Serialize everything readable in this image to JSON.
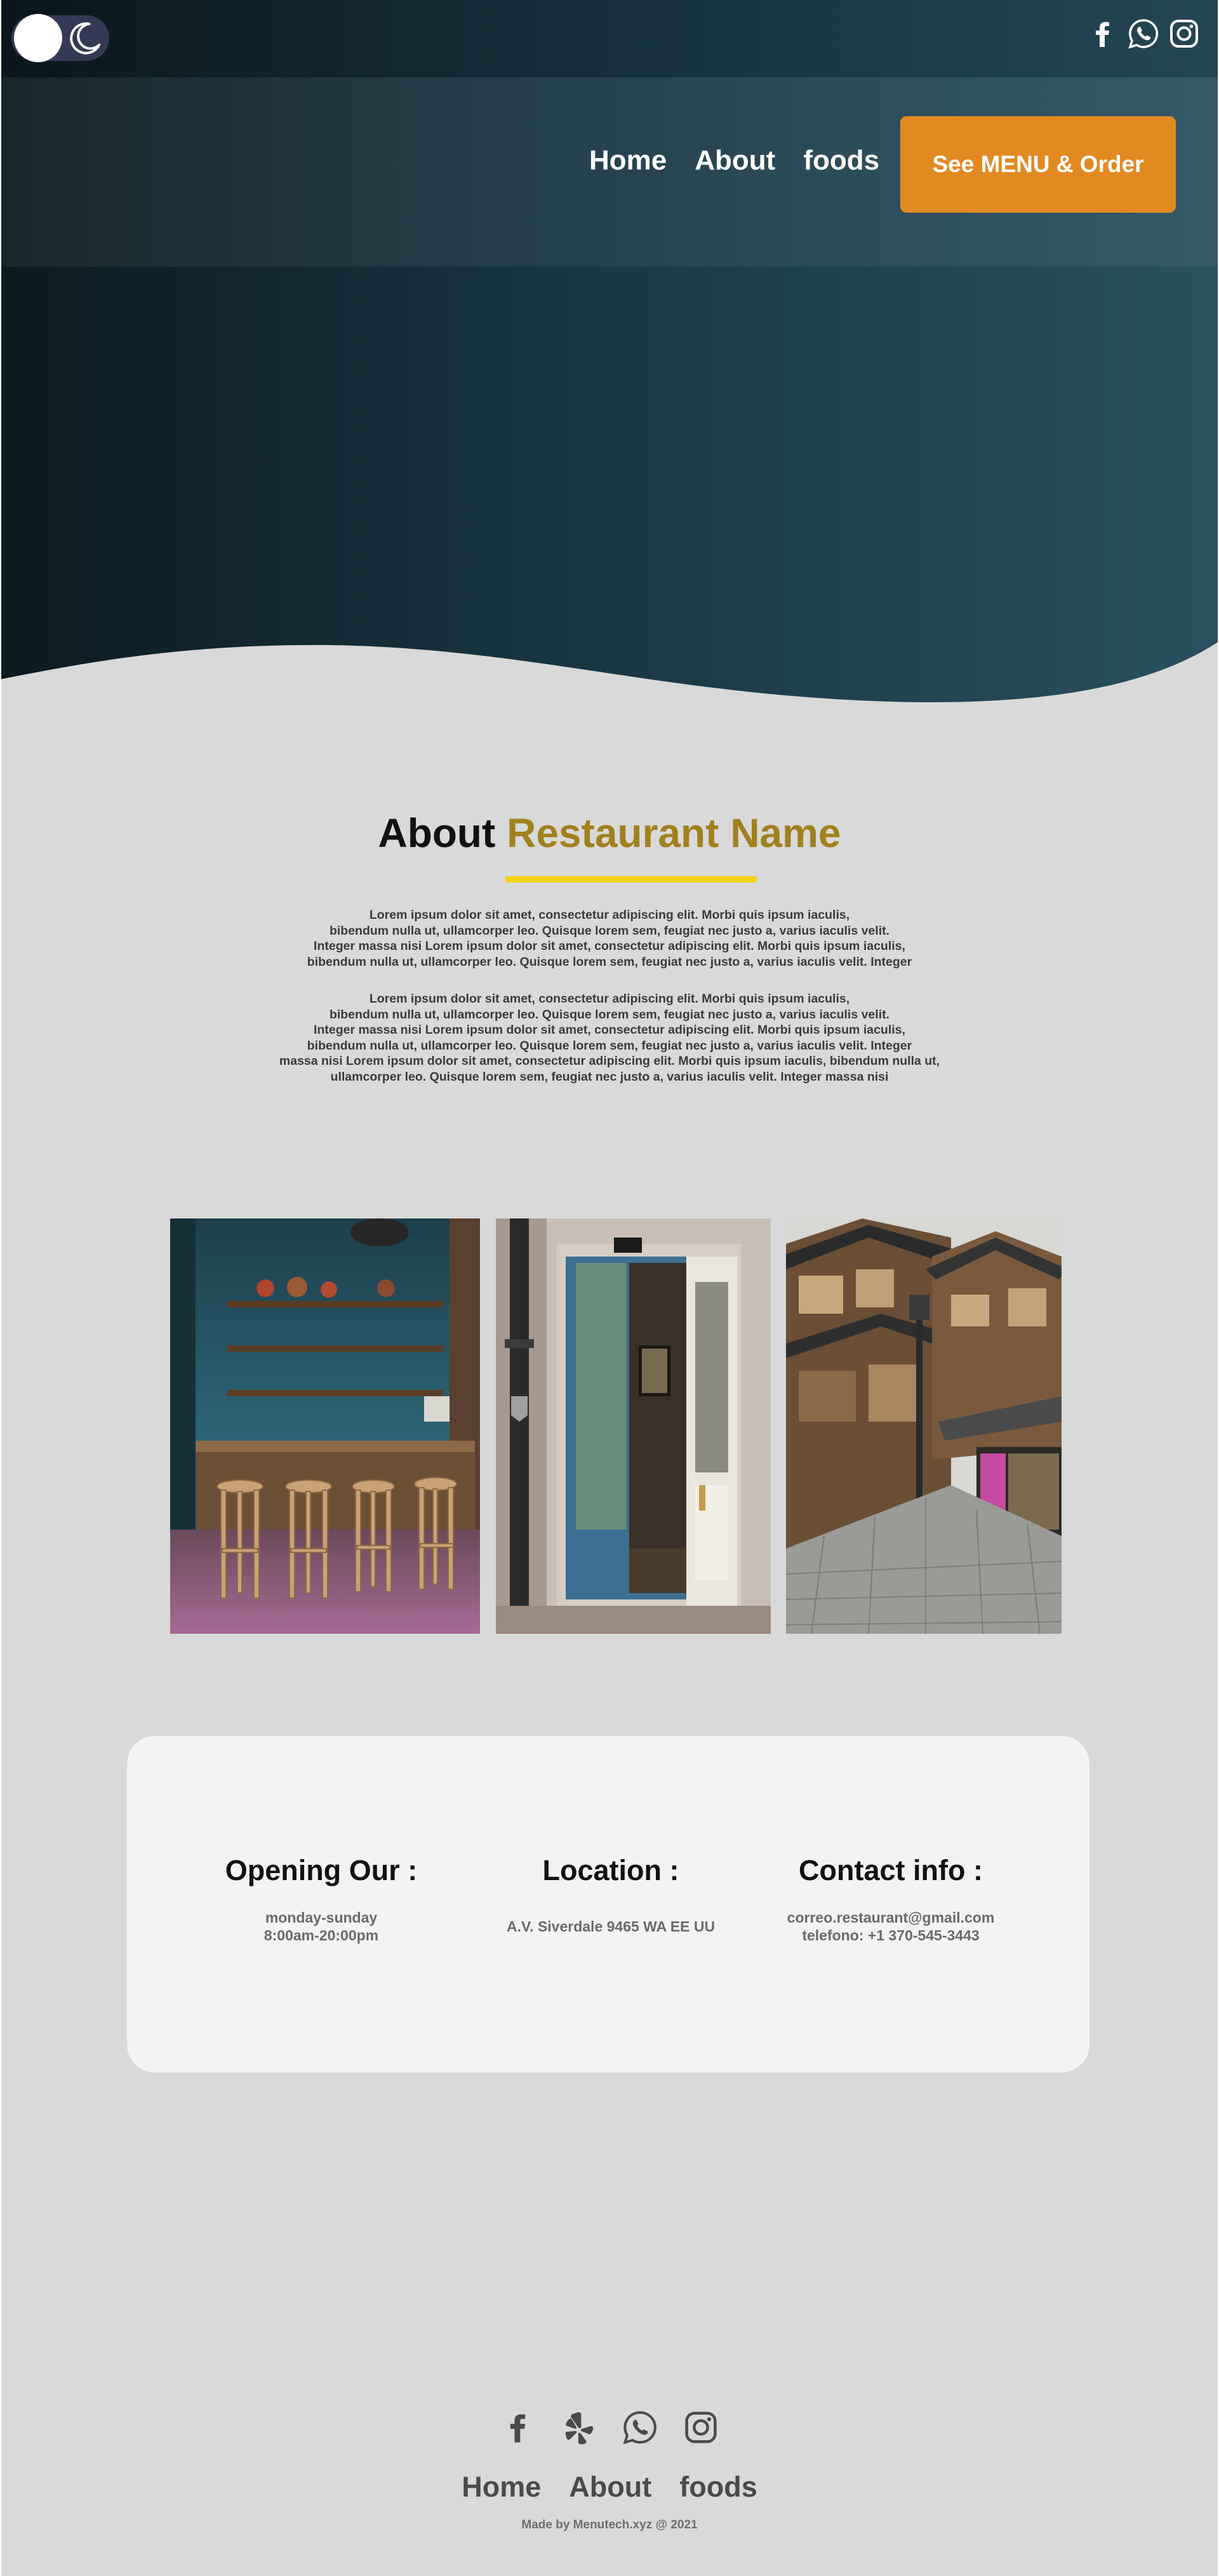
{
  "theme_toggle": {
    "state": "light",
    "icon": "moon-icon"
  },
  "social_top": [
    "facebook-icon",
    "whatsapp-icon",
    "instagram-icon"
  ],
  "nav": {
    "home": "Home",
    "about": "About",
    "foods": "foods"
  },
  "cta_label": "See MENU & Order",
  "about": {
    "title_prefix": "About",
    "title_accent": "Restaurant Name",
    "para1": [
      "Lorem ipsum dolor sit amet, consectetur adipiscing elit. Morbi quis ipsum iaculis,",
      "bibendum nulla ut, ullamcorper leo. Quisque lorem sem, feugiat nec justo a, varius iaculis velit.",
      "Integer massa nisi Lorem ipsum dolor sit amet, consectetur adipiscing elit. Morbi quis ipsum iaculis,",
      "bibendum nulla ut, ullamcorper leo. Quisque lorem sem, feugiat nec justo a, varius iaculis velit. Integer"
    ],
    "para2": [
      "Lorem ipsum dolor sit amet, consectetur adipiscing elit. Morbi quis ipsum iaculis,",
      "bibendum nulla ut, ullamcorper leo. Quisque lorem sem, feugiat nec justo a, varius iaculis velit.",
      "Integer massa nisi Lorem ipsum dolor sit amet, consectetur adipiscing elit. Morbi quis ipsum iaculis,",
      "bibendum nulla ut, ullamcorper leo. Quisque lorem sem, feugiat nec justo a, varius iaculis velit. Integer",
      "massa nisi Lorem ipsum dolor sit amet, consectetur adipiscing elit. Morbi quis ipsum iaculis, bibendum nulla ut,",
      "ullamcorper leo. Quisque lorem sem, feugiat nec justo a, varius iaculis velit. Integer massa nisi"
    ]
  },
  "info": {
    "opening": {
      "title": "Opening Our :",
      "lines": [
        "monday-sunday",
        "8:00am-20:00pm"
      ]
    },
    "location": {
      "title": "Location :",
      "lines": [
        "A.V. Siverdale 9465 WA EE UU"
      ]
    },
    "contact": {
      "title": "Contact info :",
      "lines": [
        "correo.restaurant@gmail.com",
        "telefono: +1 370-545-3443"
      ]
    }
  },
  "footer": {
    "social": [
      "facebook-icon",
      "yelp-icon",
      "whatsapp-icon",
      "instagram-icon"
    ],
    "nav": {
      "home": "Home",
      "about": "About",
      "foods": "foods"
    },
    "credit": "Made by Menutech.xyz @ 2021"
  },
  "colors": {
    "accent": "#a0811d",
    "underline": "#f1d20e",
    "cta": "#e28a22",
    "hero_dark": "#0b1a20",
    "hero_light": "#2a5060"
  }
}
